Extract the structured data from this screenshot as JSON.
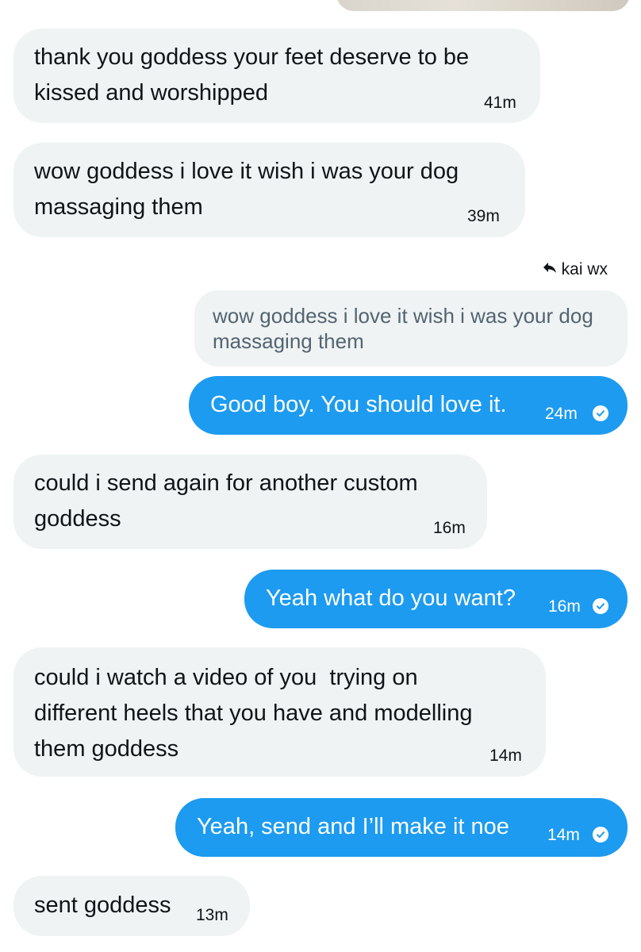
{
  "messages": [
    {
      "direction": "in",
      "text": "thank you goddess your feet deserve to be\nkissed and worshipped",
      "time": "41m"
    },
    {
      "direction": "in",
      "text": "wow goddess i love it wish i was your dog\nmassaging them",
      "time": "39m"
    },
    {
      "direction": "out",
      "reply_to_label": "kai wx",
      "quoted_text": "wow goddess i love it wish i was your dog\nmassaging them",
      "text": "Good boy. You should love it.",
      "time": "24m"
    },
    {
      "direction": "in",
      "text": "could i send again for another custom\ngoddess",
      "time": "16m"
    },
    {
      "direction": "out",
      "text": "Yeah what do you want?",
      "time": "16m"
    },
    {
      "direction": "in",
      "text": "could i watch a video of you  trying on\ndifferent heels that you have and modelling\nthem goddess",
      "time": "14m"
    },
    {
      "direction": "out",
      "text": "Yeah, send and I’ll make it noe",
      "time": "14m"
    },
    {
      "direction": "in",
      "text": "sent goddess",
      "time": "13m"
    }
  ],
  "colors": {
    "incoming_bubble": "#eff3f4",
    "outgoing_bubble": "#1d9bf0",
    "quote_text": "#536471"
  },
  "icons": {
    "reply": "reply-arrow-icon",
    "read_receipt": "checkmark-circle-icon"
  }
}
